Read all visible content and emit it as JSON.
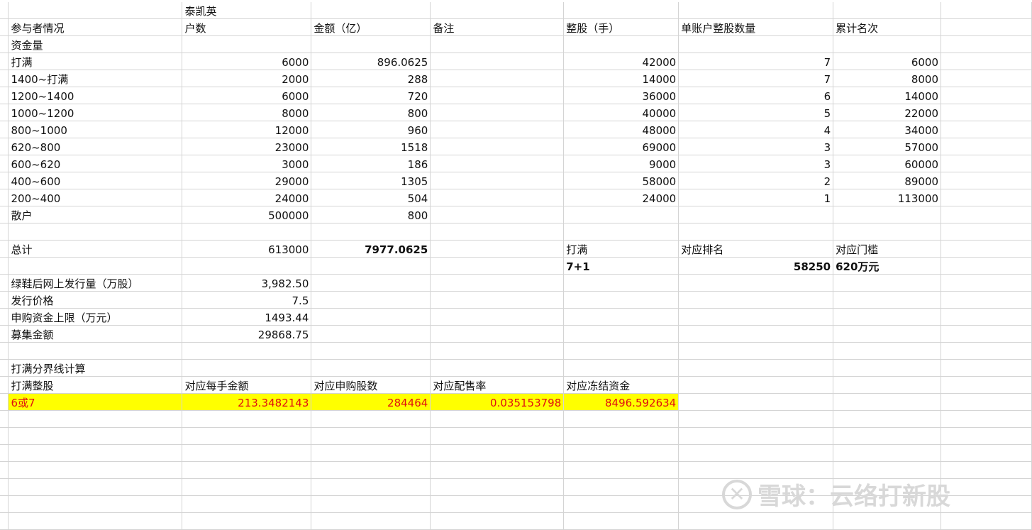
{
  "header": {
    "brand": "泰凯英"
  },
  "columns": {
    "participant": "参与者情况",
    "households": "户数",
    "amount": "金额（亿）",
    "notes": "备注",
    "whole_lots": "整股（手）",
    "per_account_lots": "单账户整股数量",
    "cumulative_rank": "累计名次"
  },
  "capital_label": "资金量",
  "rows": [
    {
      "label": "打满",
      "households": "6000",
      "amount": "896.0625",
      "lots": "42000",
      "per": "7",
      "cum": "6000"
    },
    {
      "label": "1400~打满",
      "households": "2000",
      "amount": "288",
      "lots": "14000",
      "per": "7",
      "cum": "8000"
    },
    {
      "label": "1200~1400",
      "households": "6000",
      "amount": "720",
      "lots": "36000",
      "per": "6",
      "cum": "14000"
    },
    {
      "label": "1000~1200",
      "households": "8000",
      "amount": "800",
      "lots": "40000",
      "per": "5",
      "cum": "22000"
    },
    {
      "label": "800~1000",
      "households": "12000",
      "amount": "960",
      "lots": "48000",
      "per": "4",
      "cum": "34000"
    },
    {
      "label": "620~800",
      "households": "23000",
      "amount": "1518",
      "lots": "69000",
      "per": "3",
      "cum": "57000"
    },
    {
      "label": "600~620",
      "households": "3000",
      "amount": "186",
      "lots": "9000",
      "per": "3",
      "cum": "60000"
    },
    {
      "label": "400~600",
      "households": "29000",
      "amount": "1305",
      "lots": "58000",
      "per": "2",
      "cum": "89000"
    },
    {
      "label": "200~400",
      "households": "24000",
      "amount": "504",
      "lots": "24000",
      "per": "1",
      "cum": "113000"
    },
    {
      "label": "散户",
      "households": "500000",
      "amount": "800",
      "lots": "",
      "per": "",
      "cum": ""
    }
  ],
  "total": {
    "label": "总计",
    "households": "613000",
    "amount": "7977.0625",
    "full_label": "打满",
    "rank_label": "对应排名",
    "threshold_label": "对应门槛",
    "full_value": "7+1",
    "rank_value": "58250",
    "threshold_value": "620万元"
  },
  "info": [
    {
      "label": "绿鞋后网上发行量（万股）",
      "value": "3,982.50"
    },
    {
      "label": "发行价格",
      "value": "7.5"
    },
    {
      "label": "申购资金上限（万元）",
      "value": "1493.44"
    },
    {
      "label": "募集金额",
      "value": "29868.75"
    }
  ],
  "calc": {
    "title": "打满分界线计算",
    "headers": [
      "打满整股",
      "对应每手金额",
      "对应申购股数",
      "对应配售率",
      "对应冻结资金"
    ],
    "values": [
      "6或7",
      "213.3482143",
      "284464",
      "0.035153798",
      "8496.592634"
    ]
  },
  "watermark": {
    "text": "雪球：云络打新股"
  },
  "colors": {
    "highlight": "#ffff00",
    "highlight_text": "#e01010",
    "grid": "#d4d4d4"
  }
}
